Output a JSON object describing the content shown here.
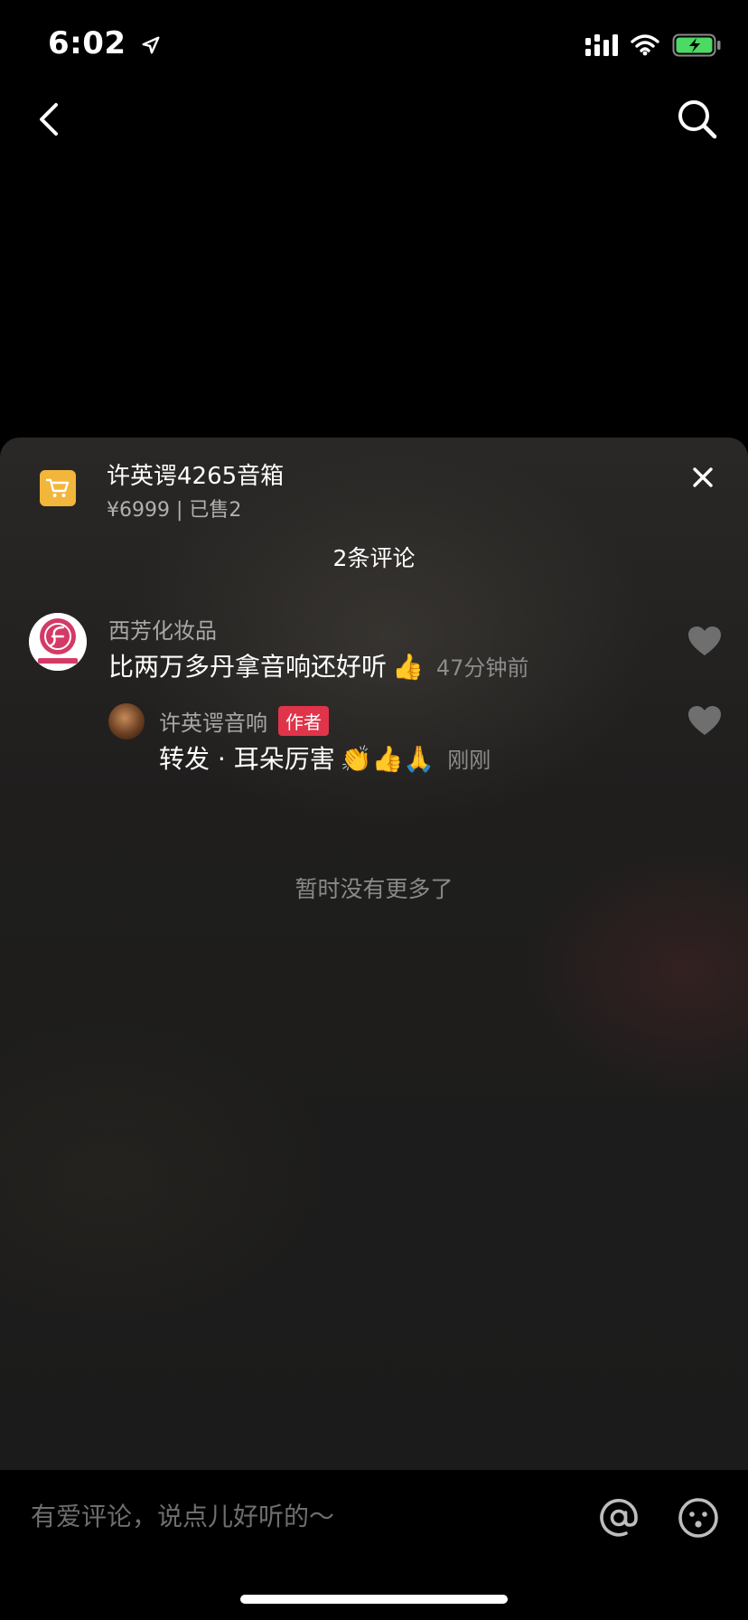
{
  "status_bar": {
    "time": "6:02"
  },
  "product": {
    "title": "许英谔4265音箱",
    "meta": "¥6999 | 已售2"
  },
  "comments_header": "2条评论",
  "comments": [
    {
      "user": "西芳化妆品",
      "text": "比两万多丹拿音响还好听",
      "emoji": "👍",
      "time": "47分钟前"
    },
    {
      "user": "许英谔音响",
      "badge": "作者",
      "text": "转发 · 耳朵厉害",
      "emoji": "👏👍🙏",
      "time": "刚刚"
    }
  ],
  "no_more_text": "暂时没有更多了",
  "input": {
    "placeholder": "有爱评论，说点儿好听的～"
  },
  "colors": {
    "author_badge": "#e0344a",
    "cart_badge": "#f2b63a",
    "battery_green": "#4cd964"
  },
  "icons": [
    "location-arrow-icon",
    "signal-icon",
    "wifi-icon",
    "battery-icon",
    "back-chevron-icon",
    "search-icon",
    "cart-icon",
    "close-icon",
    "heart-icon",
    "at-icon",
    "emoji-icon"
  ]
}
